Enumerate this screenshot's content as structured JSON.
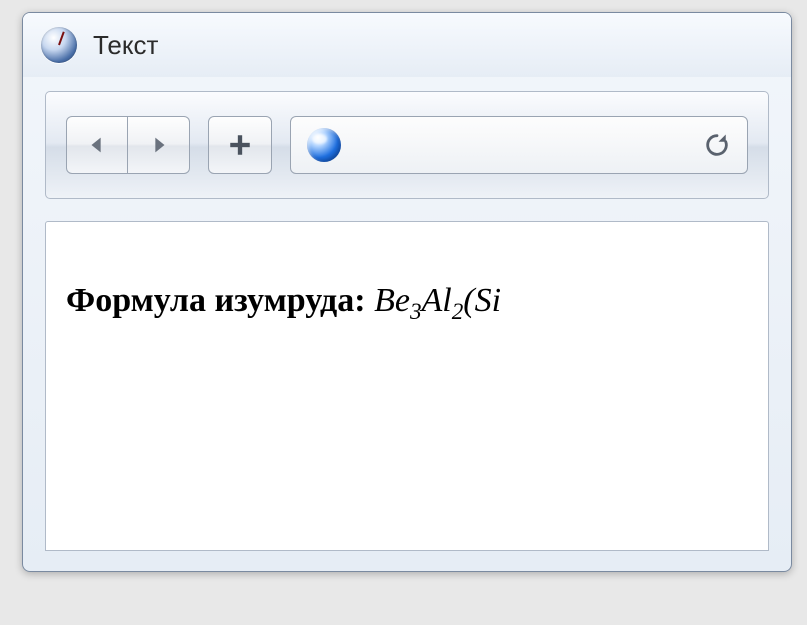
{
  "window": {
    "title": "Текст"
  },
  "toolbar": {
    "back_label": "Назад",
    "forward_label": "Вперёд",
    "newtab_label": "Новая вкладка",
    "reload_label": "Обновить"
  },
  "urlbar": {
    "value": "",
    "placeholder": ""
  },
  "content": {
    "heading_bold": "Формула изумруда: ",
    "formula_part1": "Be",
    "formula_sub1": "3",
    "formula_part2": "Al",
    "formula_sub2": "2",
    "formula_part3": "(Si"
  }
}
